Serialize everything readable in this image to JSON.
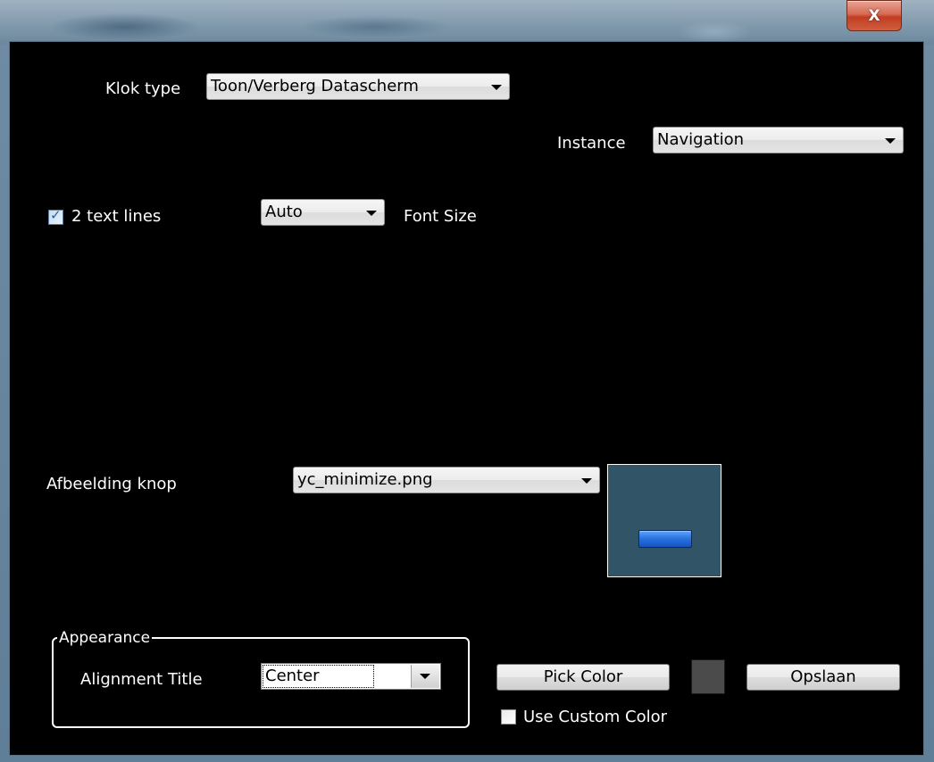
{
  "window": {
    "close_label": "X"
  },
  "form": {
    "klok_type": {
      "label": "Klok type",
      "value": "Toon/Verberg Datascherm"
    },
    "instance": {
      "label": "Instance",
      "value": "Navigation"
    },
    "text_lines": {
      "label": "2 text lines",
      "checked": true
    },
    "font_size": {
      "value": "Auto",
      "label": "Font Size"
    },
    "afbeelding": {
      "label": "Afbeelding knop",
      "value": "yc_minimize.png"
    },
    "appearance": {
      "title": "Appearance",
      "alignment_label": "Alignment Title",
      "alignment_value": "Center"
    },
    "pick_color_label": "Pick Color",
    "color_swatch": "#4b4b4b",
    "save_label": "Opslaan",
    "custom_color": {
      "label": "Use Custom Color",
      "checked": false
    }
  },
  "colors": {
    "background": "#000000",
    "preview_bg": "#315567",
    "preview_bar": "#2c74e0",
    "close_button": "#c23d22"
  }
}
